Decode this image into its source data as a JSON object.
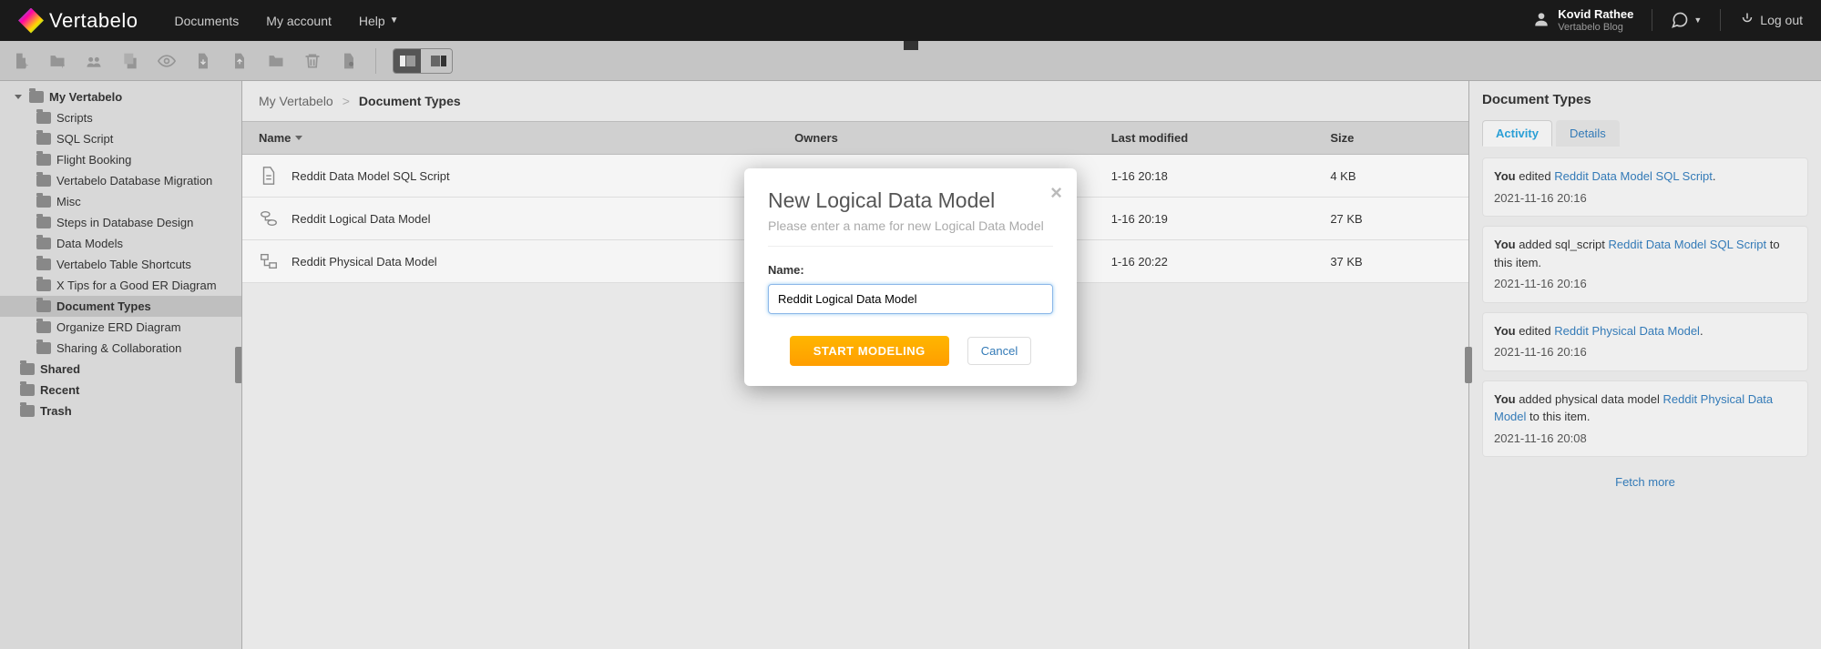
{
  "topbar": {
    "logo_text": "Vertabelo",
    "nav": {
      "documents": "Documents",
      "my_account": "My account",
      "help": "Help"
    },
    "user": {
      "name": "Kovid Rathee",
      "sub": "Vertabelo Blog"
    },
    "logout": "Log out"
  },
  "sidebar": {
    "root": "My Vertabelo",
    "items": [
      "Scripts",
      "SQL Script",
      "Flight Booking",
      "Vertabelo Database Migration",
      "Misc",
      "Steps in Database Design",
      "Data Models",
      "Vertabelo Table Shortcuts",
      "X Tips for a Good ER Diagram",
      "Document Types",
      "Organize ERD Diagram",
      "Sharing & Collaboration"
    ],
    "shared": "Shared",
    "recent": "Recent",
    "trash": "Trash"
  },
  "breadcrumb": {
    "root": "My Vertabelo",
    "sep": ">",
    "current": "Document Types"
  },
  "table": {
    "headers": {
      "name": "Name",
      "owners": "Owners",
      "modified": "Last modified",
      "size": "Size"
    },
    "rows": [
      {
        "name": "Reddit Data Model SQL Script",
        "owners": "",
        "modified": "1-16 20:18",
        "size": "4 KB",
        "icon": "file"
      },
      {
        "name": "Reddit Logical Data Model",
        "owners": "",
        "modified": "1-16 20:19",
        "size": "27 KB",
        "icon": "logical"
      },
      {
        "name": "Reddit Physical Data Model",
        "owners": "",
        "modified": "1-16 20:22",
        "size": "37 KB",
        "icon": "physical"
      }
    ]
  },
  "rightpanel": {
    "title": "Document Types",
    "tabs": {
      "activity": "Activity",
      "details": "Details"
    },
    "activities": [
      {
        "prefix": "You",
        "action": " edited ",
        "link": "Reddit Data Model SQL Script",
        "suffix": ".",
        "time": "2021-11-16 20:16"
      },
      {
        "prefix": "You",
        "action": " added sql_script ",
        "link": "Reddit Data Model SQL Script",
        "suffix": " to this item.",
        "time": "2021-11-16 20:16"
      },
      {
        "prefix": "You",
        "action": " edited ",
        "link": "Reddit Physical Data Model",
        "suffix": ".",
        "time": "2021-11-16 20:16"
      },
      {
        "prefix": "You",
        "action": " added physical data model ",
        "link": "Reddit Physical Data Model",
        "suffix": " to this item.",
        "time": "2021-11-16 20:08"
      }
    ],
    "fetch_more": "Fetch more"
  },
  "modal": {
    "title": "New Logical Data Model",
    "subtitle": "Please enter a name for new Logical Data Model",
    "name_label": "Name:",
    "name_value": "Reddit Logical Data Model",
    "primary": "START MODELING",
    "cancel": "Cancel"
  }
}
